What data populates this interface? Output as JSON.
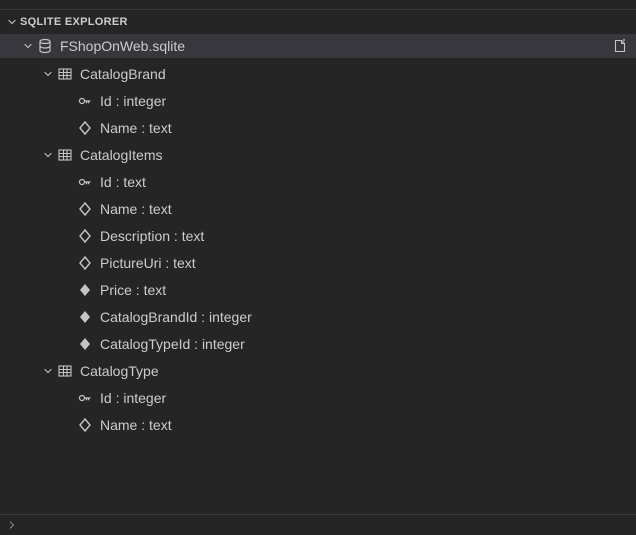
{
  "explorer": {
    "title": "SQLITE EXPLORER",
    "database": "FShopOnWeb.sqlite",
    "tables": [
      {
        "name": "CatalogBrand",
        "columns": [
          {
            "name": "Id : integer",
            "role": "pk"
          },
          {
            "name": "Name : text",
            "role": "col"
          }
        ]
      },
      {
        "name": "CatalogItems",
        "columns": [
          {
            "name": "Id : text",
            "role": "pk"
          },
          {
            "name": "Name : text",
            "role": "col"
          },
          {
            "name": "Description : text",
            "role": "col"
          },
          {
            "name": "PictureUri : text",
            "role": "col"
          },
          {
            "name": "Price : text",
            "role": "fk"
          },
          {
            "name": "CatalogBrandId : integer",
            "role": "fk"
          },
          {
            "name": "CatalogTypeId : integer",
            "role": "fk"
          }
        ]
      },
      {
        "name": "CatalogType",
        "columns": [
          {
            "name": "Id : integer",
            "role": "pk"
          },
          {
            "name": "Name : text",
            "role": "col"
          }
        ]
      }
    ]
  }
}
